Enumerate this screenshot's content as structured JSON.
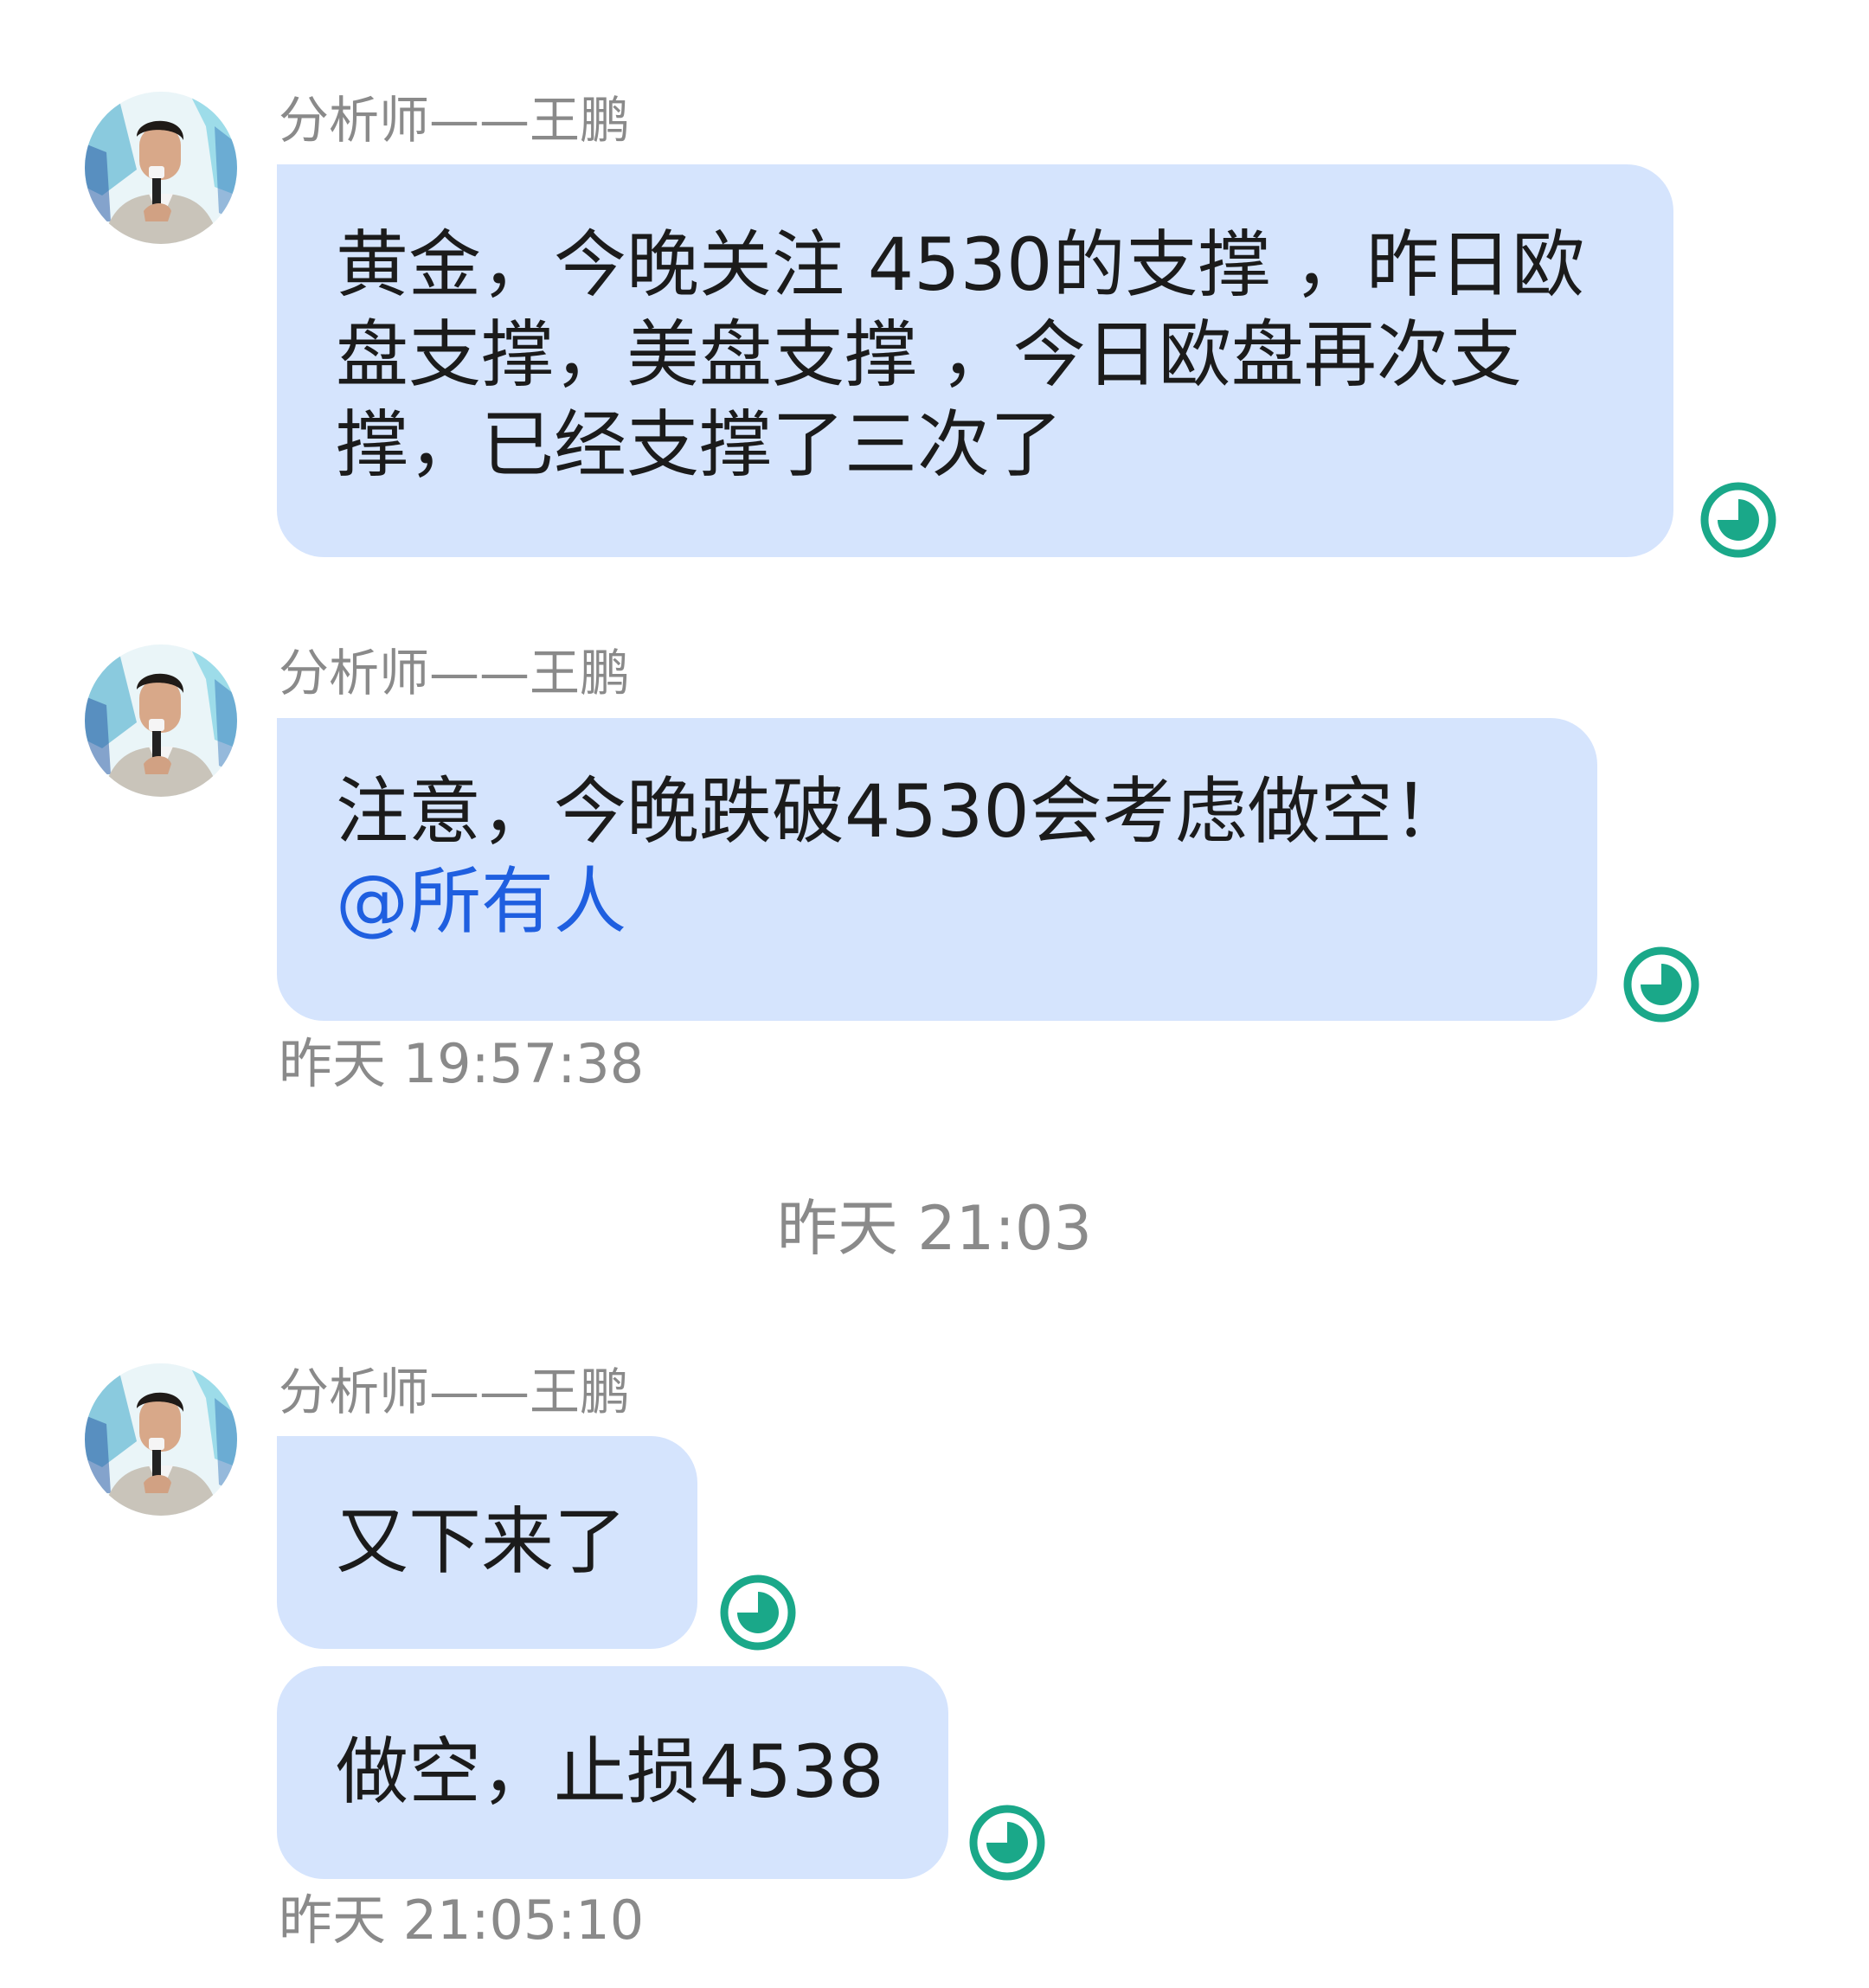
{
  "sender_name": "分析师——王鹏",
  "messages": [
    {
      "text": "黄金，今晚关注 4530的支撑 ，昨日欧盘支撑，美盘支撑 ，今日欧盘再次支撑，已经支撑了三次了"
    },
    {
      "text": "注意，今晚跌破4530会考虑做空！",
      "mention": "@所有人"
    },
    {
      "text": "又下来了"
    },
    {
      "text": "做空，止损4538"
    }
  ],
  "timestamps": {
    "first_group": "昨天 19:57:38",
    "divider": "昨天 21:03",
    "second_group": "昨天 21:05:10"
  },
  "icons": {
    "avatar": "analyst-avatar-photo",
    "status": "read-status-icon"
  },
  "colors": {
    "bubble": "#d5e4fd",
    "mention": "#1f5fe0",
    "status": "#1aa889",
    "muted_text": "#8a8a8a"
  }
}
